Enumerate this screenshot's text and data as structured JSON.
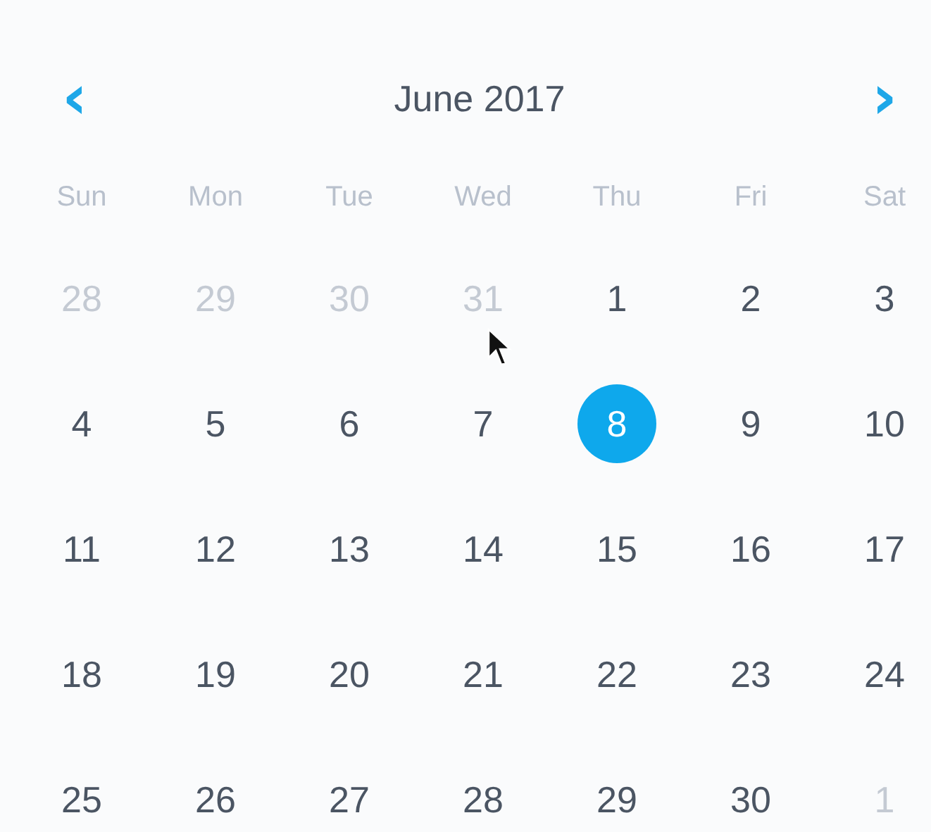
{
  "header": {
    "prev": "‹",
    "title": "June 2017",
    "next": "›"
  },
  "weekdays": [
    "Sun",
    "Mon",
    "Tue",
    "Wed",
    "Thu",
    "Fri",
    "Sat"
  ],
  "weeks": [
    [
      {
        "day": "28",
        "muted": true,
        "selected": false
      },
      {
        "day": "29",
        "muted": true,
        "selected": false
      },
      {
        "day": "30",
        "muted": true,
        "selected": false
      },
      {
        "day": "31",
        "muted": true,
        "selected": false
      },
      {
        "day": "1",
        "muted": false,
        "selected": false
      },
      {
        "day": "2",
        "muted": false,
        "selected": false
      },
      {
        "day": "3",
        "muted": false,
        "selected": false
      }
    ],
    [
      {
        "day": "4",
        "muted": false,
        "selected": false
      },
      {
        "day": "5",
        "muted": false,
        "selected": false
      },
      {
        "day": "6",
        "muted": false,
        "selected": false
      },
      {
        "day": "7",
        "muted": false,
        "selected": false
      },
      {
        "day": "8",
        "muted": false,
        "selected": true
      },
      {
        "day": "9",
        "muted": false,
        "selected": false
      },
      {
        "day": "10",
        "muted": false,
        "selected": false
      }
    ],
    [
      {
        "day": "11",
        "muted": false,
        "selected": false
      },
      {
        "day": "12",
        "muted": false,
        "selected": false
      },
      {
        "day": "13",
        "muted": false,
        "selected": false
      },
      {
        "day": "14",
        "muted": false,
        "selected": false
      },
      {
        "day": "15",
        "muted": false,
        "selected": false
      },
      {
        "day": "16",
        "muted": false,
        "selected": false
      },
      {
        "day": "17",
        "muted": false,
        "selected": false
      }
    ],
    [
      {
        "day": "18",
        "muted": false,
        "selected": false
      },
      {
        "day": "19",
        "muted": false,
        "selected": false
      },
      {
        "day": "20",
        "muted": false,
        "selected": false
      },
      {
        "day": "21",
        "muted": false,
        "selected": false
      },
      {
        "day": "22",
        "muted": false,
        "selected": false
      },
      {
        "day": "23",
        "muted": false,
        "selected": false
      },
      {
        "day": "24",
        "muted": false,
        "selected": false
      }
    ],
    [
      {
        "day": "25",
        "muted": false,
        "selected": false
      },
      {
        "day": "26",
        "muted": false,
        "selected": false
      },
      {
        "day": "27",
        "muted": false,
        "selected": false
      },
      {
        "day": "28",
        "muted": false,
        "selected": false
      },
      {
        "day": "29",
        "muted": false,
        "selected": false
      },
      {
        "day": "30",
        "muted": false,
        "selected": false
      },
      {
        "day": "1",
        "muted": true,
        "selected": false
      }
    ]
  ]
}
